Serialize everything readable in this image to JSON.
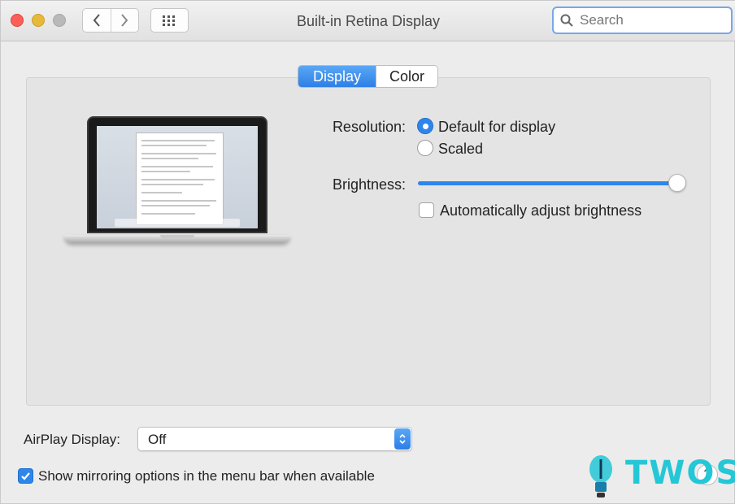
{
  "window": {
    "title": "Built-in Retina Display"
  },
  "toolbar": {
    "search_placeholder": "Search",
    "icons": {
      "back": "chevron-left-icon",
      "forward": "chevron-right-icon",
      "show_all": "grid-icon",
      "search": "magnifier-icon"
    }
  },
  "tabs": [
    {
      "label": "Display",
      "selected": true
    },
    {
      "label": "Color",
      "selected": false
    }
  ],
  "display": {
    "resolution_label": "Resolution:",
    "resolution_options": [
      {
        "label": "Default for display",
        "selected": true
      },
      {
        "label": "Scaled",
        "selected": false
      }
    ],
    "brightness_label": "Brightness:",
    "brightness_value": 1.0,
    "auto_brightness_label": "Automatically adjust brightness",
    "auto_brightness_checked": false
  },
  "airplay": {
    "label": "AirPlay Display:",
    "value": "Off"
  },
  "mirroring": {
    "label": "Show mirroring options in the menu bar when available",
    "checked": true
  },
  "watermark": {
    "text": "TWOS"
  },
  "help": {
    "label": "?"
  },
  "colors": {
    "accent": "#2f86ea",
    "close": "#fc5f57",
    "minimize": "#e6b93a",
    "watermark": "#25c7d6"
  }
}
